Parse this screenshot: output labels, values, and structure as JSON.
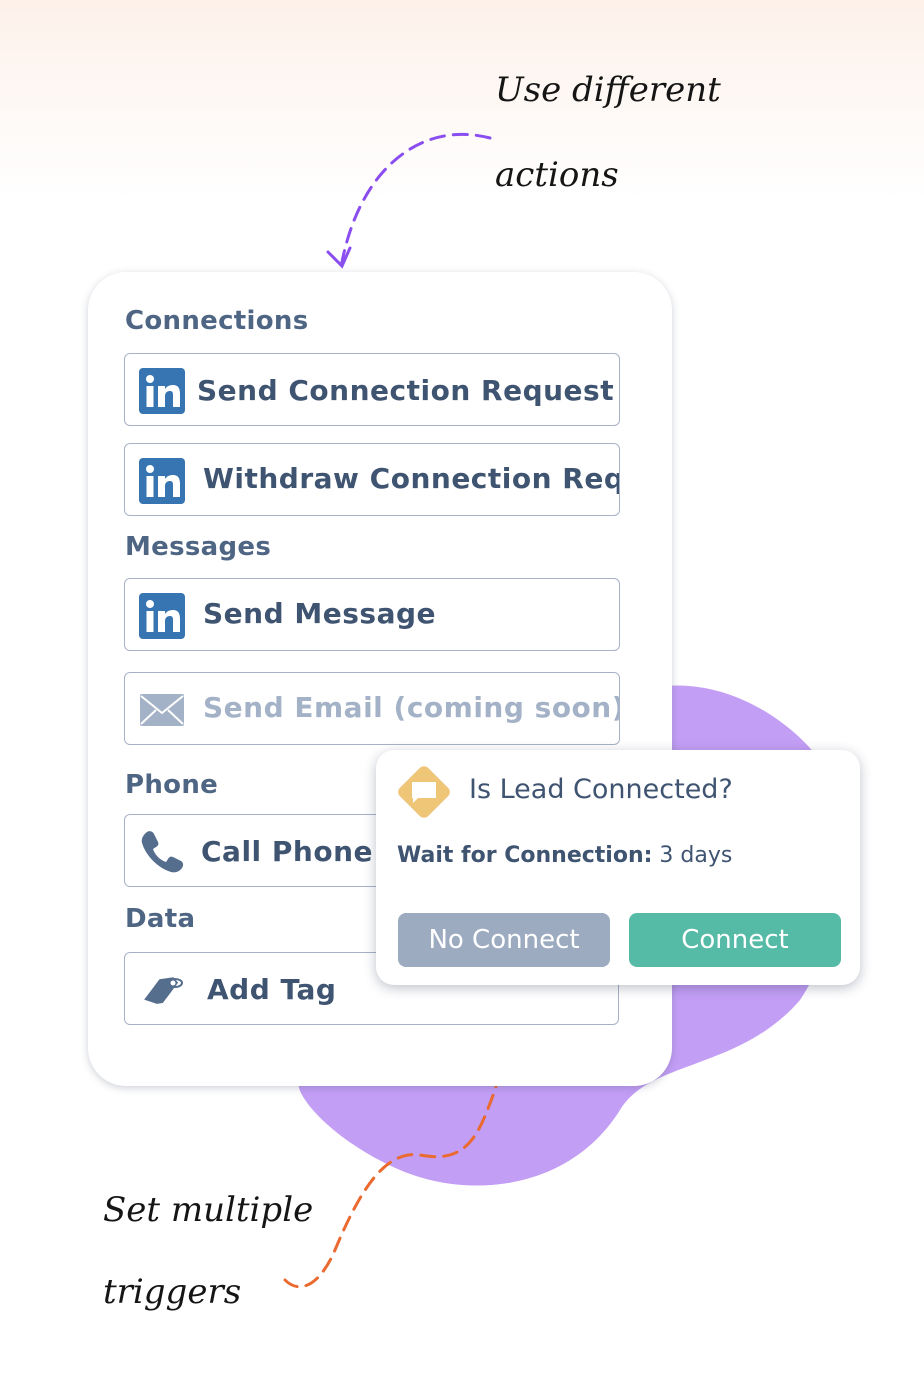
{
  "annotations": {
    "top_line1": "Use different",
    "top_line2": "actions",
    "bottom_line1": "Set multiple",
    "bottom_line2": "triggers"
  },
  "colors": {
    "purple_arrow": "#8a4ef0",
    "orange_arrow": "#ea6a30",
    "blob": "#c39ef5",
    "linkedin": "#3674b2",
    "connect": "#55bba6",
    "no_connect": "#9dabc1",
    "condition_icon": "#efc578"
  },
  "actions_panel": {
    "sections": [
      {
        "title": "Connections",
        "items": [
          {
            "label": "Send Connection Request",
            "icon": "linkedin-icon"
          },
          {
            "label": "Withdraw Connection Reques",
            "icon": "linkedin-icon"
          }
        ]
      },
      {
        "title": "Messages",
        "items": [
          {
            "label": "Send Message",
            "icon": "linkedin-icon"
          },
          {
            "label": "Send Email (coming soon)",
            "icon": "mail-icon",
            "disabled": true
          }
        ]
      },
      {
        "title": "Phone",
        "items": [
          {
            "label": "Call Phone",
            "icon": "phone-icon"
          }
        ]
      },
      {
        "title": "Data",
        "items": [
          {
            "label": "Add Tag",
            "icon": "tag-icon"
          }
        ]
      }
    ]
  },
  "condition_popup": {
    "title": "Is Lead Connected?",
    "wait_label": "Wait for Connection:",
    "wait_value": "3 days",
    "no_button": "No Connect",
    "yes_button": "Connect"
  }
}
